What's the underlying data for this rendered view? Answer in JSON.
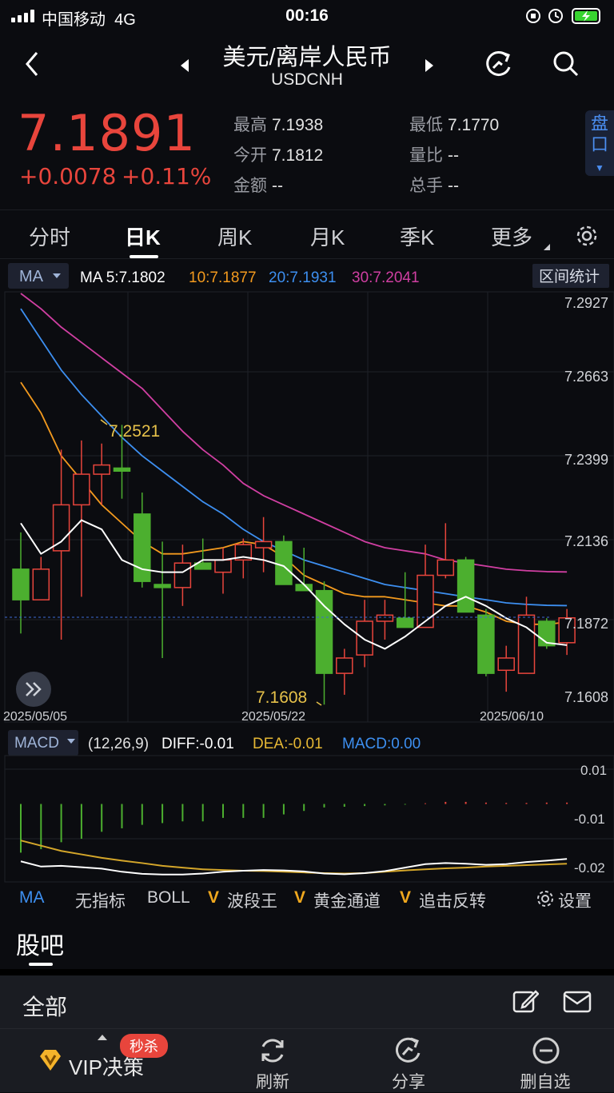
{
  "status_bar": {
    "carrier": "中国移动",
    "network": "4G",
    "time": "00:16"
  },
  "header": {
    "title": "美元/离岸人民币",
    "symbol": "USDCNH"
  },
  "quote": {
    "price": "7.1891",
    "change": "+0.0078",
    "change_pct": "+0.11%",
    "high_label": "最高",
    "high": "7.1938",
    "low_label": "最低",
    "low": "7.1770",
    "open_label": "今开",
    "open": "7.1812",
    "vol_ratio_label": "量比",
    "vol_ratio": "--",
    "amount_label": "金额",
    "amount": "--",
    "total_label": "总手",
    "total": "--",
    "side_panel": "盘口",
    "up_color": "#e8453c"
  },
  "tabs": [
    {
      "label": "分时"
    },
    {
      "label": "日K",
      "active": true
    },
    {
      "label": "周K"
    },
    {
      "label": "月K"
    },
    {
      "label": "季K"
    },
    {
      "label": "更多"
    }
  ],
  "ma_bar": {
    "selector": "MA",
    "ma5": "MA 5:7.1802",
    "ma10": "10:7.1877",
    "ma20": "20:7.1931",
    "ma30": "30:7.2041",
    "stats_button": "区间统计"
  },
  "price_axis": [
    "7.2927",
    "7.2663",
    "7.2399",
    "7.2136",
    "7.1872",
    "7.1608"
  ],
  "date_axis": [
    "2025/05/05",
    "2025/05/22",
    "2025/06/10"
  ],
  "annotations": {
    "max": "7.2521",
    "min": "7.1608"
  },
  "macd_bar": {
    "selector": "MACD",
    "params": "(12,26,9)",
    "diff": "DIFF:-0.01",
    "dea": "DEA:-0.01",
    "macd": "MACD:0.00"
  },
  "macd_axis": [
    "0.01",
    "-0.01",
    "-0.02"
  ],
  "indicators": [
    {
      "label": "MA",
      "active": true
    },
    {
      "label": "无指标"
    },
    {
      "label": "BOLL"
    },
    {
      "label": "波段王",
      "vip": true
    },
    {
      "label": "黄金通道",
      "vip": true
    },
    {
      "label": "追击反转",
      "vip": true
    },
    {
      "label": "设置"
    }
  ],
  "guba": {
    "title": "股吧"
  },
  "feed": {
    "filter": "全部"
  },
  "bottom_bar": {
    "vip": "VIP决策",
    "badge": "秒杀",
    "refresh": "刷新",
    "share": "分享",
    "remove": "删自选"
  },
  "colors": {
    "up": "#e8453c",
    "down": "#4caf2f",
    "ma5": "#ffffff",
    "ma10": "#f39a1e",
    "ma20": "#3d8ff0",
    "ma30": "#d03fa2",
    "dea": "#d4a62a"
  },
  "chart_data": {
    "type": "candlestick",
    "categories": [
      "2025/05/05",
      "",
      "",
      "",
      "",
      "",
      "",
      "",
      "",
      "",
      "",
      "",
      "",
      "",
      "2025/05/22",
      "",
      "",
      "",
      "",
      "",
      "",
      "",
      "",
      "",
      "",
      "",
      "",
      "2025/06/10"
    ],
    "ohlc": [
      [
        7.205,
        7.217,
        7.184,
        7.195
      ],
      [
        7.195,
        7.209,
        7.203,
        7.205
      ],
      [
        7.211,
        7.244,
        7.182,
        7.226
      ],
      [
        7.226,
        7.247,
        7.196,
        7.236
      ],
      [
        7.236,
        7.246,
        7.226,
        7.239
      ],
      [
        7.238,
        7.2521,
        7.228,
        7.237
      ],
      [
        7.223,
        7.23,
        7.199,
        7.201
      ],
      [
        7.2,
        7.214,
        7.176,
        7.199
      ],
      [
        7.199,
        7.213,
        7.193,
        7.207
      ],
      [
        7.207,
        7.215,
        7.205,
        7.205
      ],
      [
        7.204,
        7.212,
        7.197,
        7.208
      ],
      [
        7.208,
        7.215,
        7.202,
        7.213
      ],
      [
        7.212,
        7.222,
        7.204,
        7.214
      ],
      [
        7.214,
        7.216,
        7.206,
        7.2
      ],
      [
        7.2,
        7.212,
        7.198,
        7.198
      ],
      [
        7.198,
        7.201,
        7.1608,
        7.171
      ],
      [
        7.171,
        7.179,
        7.164,
        7.176
      ],
      [
        7.177,
        7.195,
        7.173,
        7.188
      ],
      [
        7.188,
        7.195,
        7.182,
        7.19
      ],
      [
        7.189,
        7.204,
        7.186,
        7.186
      ],
      [
        7.186,
        7.213,
        7.188,
        7.203
      ],
      [
        7.203,
        7.22,
        7.202,
        7.208
      ],
      [
        7.208,
        7.209,
        7.192,
        7.191
      ],
      [
        7.19,
        7.192,
        7.17,
        7.171
      ],
      [
        7.172,
        7.18,
        7.165,
        7.176
      ],
      [
        7.171,
        7.196,
        7.171,
        7.19
      ],
      [
        7.188,
        7.189,
        7.179,
        7.18
      ],
      [
        7.181,
        7.192,
        7.177,
        7.1891
      ]
    ],
    "ma5": [
      7.22,
      7.21,
      7.214,
      7.221,
      7.218,
      7.208,
      7.205,
      7.204,
      7.204,
      7.208,
      7.208,
      7.209,
      7.208,
      7.206,
      7.2,
      7.193,
      7.187,
      7.182,
      7.179,
      7.183,
      7.188,
      7.193,
      7.196,
      7.193,
      7.189,
      7.186,
      7.181,
      7.1802
    ],
    "ma10": [
      7.266,
      7.256,
      7.242,
      7.234,
      7.226,
      7.22,
      7.214,
      7.21,
      7.21,
      7.211,
      7.212,
      7.214,
      7.213,
      7.209,
      7.203,
      7.2,
      7.197,
      7.196,
      7.196,
      7.195,
      7.194,
      7.193,
      7.193,
      7.191,
      7.188,
      7.187,
      7.187,
      7.1877
    ],
    "ma20": [
      7.29,
      7.28,
      7.27,
      7.262,
      7.255,
      7.248,
      7.242,
      7.237,
      7.232,
      7.227,
      7.223,
      7.218,
      7.214,
      7.211,
      7.208,
      7.206,
      7.204,
      7.202,
      7.2,
      7.199,
      7.198,
      7.197,
      7.196,
      7.195,
      7.194,
      7.1935,
      7.1932,
      7.1931
    ],
    "ma30": [
      7.295,
      7.29,
      7.284,
      7.279,
      7.274,
      7.269,
      7.264,
      7.257,
      7.25,
      7.244,
      7.239,
      7.233,
      7.229,
      7.226,
      7.223,
      7.22,
      7.217,
      7.214,
      7.212,
      7.211,
      7.21,
      7.208,
      7.207,
      7.206,
      7.205,
      7.2045,
      7.2042,
      7.2041
    ],
    "macd": [
      -0.014,
      -0.013,
      -0.011,
      -0.01,
      -0.008,
      -0.007,
      -0.006,
      -0.0055,
      -0.005,
      -0.005,
      -0.004,
      -0.004,
      -0.004,
      -0.003,
      -0.002,
      -0.001,
      -0.0008,
      -0.0006,
      -0.0004,
      -0.0002,
      0.0002,
      0.0006,
      0.0006,
      0.0004,
      0.0003,
      0.0003,
      0.0004,
      0.0004
    ],
    "diff": [
      -0.0165,
      -0.018,
      -0.0178,
      -0.0182,
      -0.0186,
      -0.0195,
      -0.0201,
      -0.0203,
      -0.0203,
      -0.02,
      -0.0195,
      -0.0192,
      -0.019,
      -0.0191,
      -0.0194,
      -0.02,
      -0.0202,
      -0.0199,
      -0.0193,
      -0.0183,
      -0.0173,
      -0.017,
      -0.0172,
      -0.0175,
      -0.0173,
      -0.0167,
      -0.0163,
      -0.0158
    ],
    "dea": [
      -0.0105,
      -0.012,
      -0.0135,
      -0.0145,
      -0.0155,
      -0.0163,
      -0.017,
      -0.0178,
      -0.0183,
      -0.0188,
      -0.019,
      -0.0192,
      -0.0193,
      -0.0195,
      -0.0197,
      -0.0199,
      -0.02,
      -0.0199,
      -0.0195,
      -0.0191,
      -0.0188,
      -0.0185,
      -0.0183,
      -0.018,
      -0.0178,
      -0.0176,
      -0.0174,
      -0.0172
    ],
    "ylim": [
      7.1572,
      7.295
    ],
    "macd_ylim": [
      -0.0215,
      0.013
    ]
  }
}
